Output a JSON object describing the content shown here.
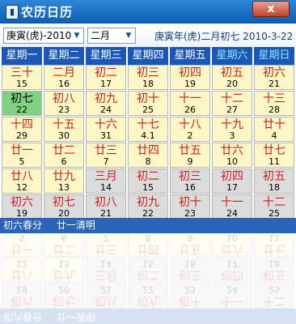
{
  "window": {
    "title": "农历日历",
    "icon": "calendar-icon",
    "close_label": "x"
  },
  "toolbar": {
    "year_select": "庚寅(虎)-2010",
    "month_select": "二月",
    "lunar_info": "庚寅年(虎)二月初七  2010-3-22"
  },
  "weekdays": [
    "星期一",
    "星期二",
    "星期三",
    "星期四",
    "星期五",
    "星期六",
    "星期日"
  ],
  "weeks": [
    [
      {
        "l": "三十",
        "s": "15"
      },
      {
        "l": "二月",
        "s": "16"
      },
      {
        "l": "初二",
        "s": "17"
      },
      {
        "l": "初三",
        "s": "18"
      },
      {
        "l": "初四",
        "s": "19"
      },
      {
        "l": "初五",
        "s": "20"
      },
      {
        "l": "初六",
        "s": "21"
      }
    ],
    [
      {
        "l": "初七",
        "s": "22"
      },
      {
        "l": "初八",
        "s": "23"
      },
      {
        "l": "初九",
        "s": "24"
      },
      {
        "l": "初十",
        "s": "25"
      },
      {
        "l": "十一",
        "s": "26"
      },
      {
        "l": "十二",
        "s": "27"
      },
      {
        "l": "十三",
        "s": "28"
      }
    ],
    [
      {
        "l": "十四",
        "s": "29"
      },
      {
        "l": "十五",
        "s": "30"
      },
      {
        "l": "十六",
        "s": "31"
      },
      {
        "l": "十七",
        "s": "4.1"
      },
      {
        "l": "十八",
        "s": "2"
      },
      {
        "l": "十九",
        "s": "3"
      },
      {
        "l": "廿十",
        "s": "4"
      }
    ],
    [
      {
        "l": "廿一",
        "s": "5"
      },
      {
        "l": "廿二",
        "s": "6"
      },
      {
        "l": "廿三",
        "s": "7"
      },
      {
        "l": "廿四",
        "s": "8"
      },
      {
        "l": "廿五",
        "s": "9"
      },
      {
        "l": "廿六",
        "s": "10"
      },
      {
        "l": "廿七",
        "s": "11"
      }
    ],
    [
      {
        "l": "廿八",
        "s": "12"
      },
      {
        "l": "廿九",
        "s": "13"
      },
      {
        "l": "三月",
        "s": "14"
      },
      {
        "l": "初二",
        "s": "15"
      },
      {
        "l": "初三",
        "s": "16"
      },
      {
        "l": "初四",
        "s": "17"
      },
      {
        "l": "初五",
        "s": "18"
      }
    ],
    [
      {
        "l": "初六",
        "s": "19"
      },
      {
        "l": "初七",
        "s": "20"
      },
      {
        "l": "初八",
        "s": "21"
      },
      {
        "l": "初九",
        "s": "22"
      },
      {
        "l": "初十",
        "s": "23"
      },
      {
        "l": "十一",
        "s": "24"
      },
      {
        "l": "十二",
        "s": "25"
      }
    ]
  ],
  "today": {
    "week": 1,
    "day": 0
  },
  "gray_cells": [
    [
      4,
      2
    ],
    [
      4,
      3
    ],
    [
      4,
      4
    ],
    [
      4,
      5
    ],
    [
      4,
      6
    ],
    [
      5,
      0
    ],
    [
      5,
      1
    ],
    [
      5,
      2
    ],
    [
      5,
      3
    ],
    [
      5,
      4
    ],
    [
      5,
      5
    ],
    [
      5,
      6
    ]
  ],
  "footer": {
    "solar_term_1": "初六春分",
    "solar_term_2": "廿一清明"
  },
  "colors": {
    "title_bar": "#0b5fb5",
    "weekday_bg": "#1b57b6",
    "weekend_text": "#8fe7ff",
    "cell_bg": "#fdf7c6",
    "cell_gray": "#dcdcdc",
    "today_bg": "#7fd27f",
    "lunar_text": "#d11b1b"
  }
}
